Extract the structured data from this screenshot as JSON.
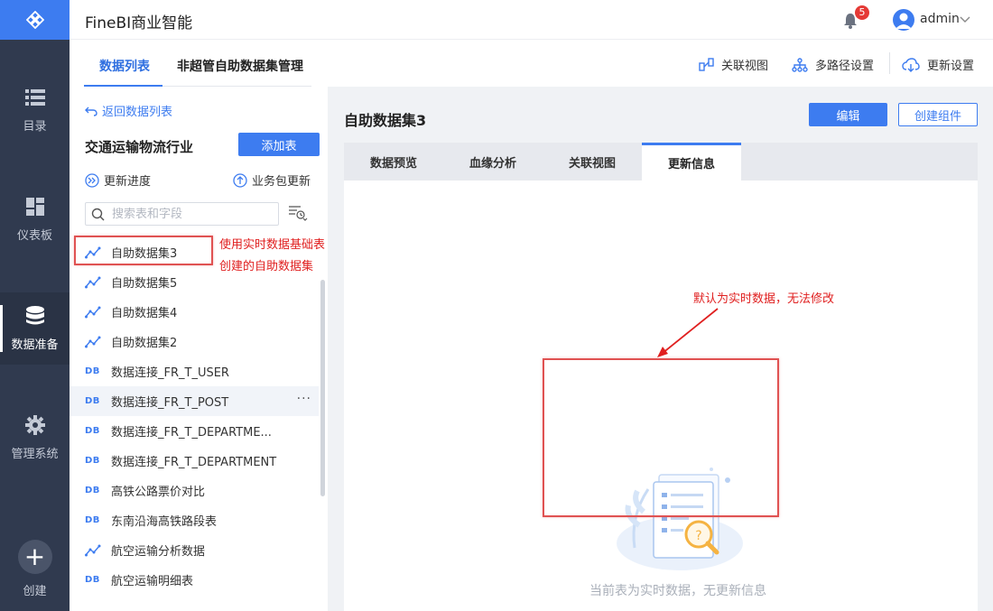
{
  "app": {
    "title": "FineBI商业智能"
  },
  "header": {
    "notification_count": "5",
    "username": "admin"
  },
  "sidebar": {
    "items": [
      {
        "label": "目录",
        "icon": "list-icon"
      },
      {
        "label": "仪表板",
        "icon": "dashboard-icon"
      },
      {
        "label": "数据准备",
        "icon": "database-icon",
        "active": true
      },
      {
        "label": "管理系统",
        "icon": "gear-icon"
      },
      {
        "label": "创建",
        "icon": "plus-icon"
      }
    ]
  },
  "subheader": {
    "tabs": [
      "数据列表",
      "非超管自助数据集管理"
    ],
    "tools": [
      "关联视图",
      "多路径设置",
      "更新设置"
    ]
  },
  "left_panel": {
    "back_link": "返回数据列表",
    "package_title": "交通运输物流行业",
    "add_table_button": "添加表",
    "progress_link": "更新进度",
    "package_update_link": "业务包更新",
    "search_placeholder": "搜索表和字段",
    "tables": [
      {
        "name": "自助数据集3",
        "type": "self-service"
      },
      {
        "name": "自助数据集5",
        "type": "self-service"
      },
      {
        "name": "自助数据集4",
        "type": "self-service"
      },
      {
        "name": "自助数据集2",
        "type": "self-service"
      },
      {
        "name": "数据连接_FR_T_USER",
        "type": "db"
      },
      {
        "name": "数据连接_FR_T_POST",
        "type": "db"
      },
      {
        "name": "数据连接_FR_T_DEPARTME...",
        "type": "db"
      },
      {
        "name": "数据连接_FR_T_DEPARTMENT",
        "type": "db"
      },
      {
        "name": "高铁公路票价对比",
        "type": "db"
      },
      {
        "name": "东南沿海高铁路段表",
        "type": "db"
      },
      {
        "name": "航空运输分析数据",
        "type": "self-service"
      },
      {
        "name": "航空运输明细表",
        "type": "db"
      }
    ],
    "db_badge": "DB",
    "more_dots": "···"
  },
  "annotations": {
    "side_note_line1": "使用实时数据基础表",
    "side_note_line2": "创建的自助数据集",
    "arrow_note": "默认为实时数据，无法修改"
  },
  "right_panel": {
    "dataset_title": "自助数据集3",
    "edit_button": "编辑",
    "create_component_button": "创建组件",
    "tabs": [
      "数据预览",
      "血缘分析",
      "关联视图",
      "更新信息"
    ],
    "active_tab": "更新信息",
    "empty_message": "当前表为实时数据，无更新信息"
  },
  "colors": {
    "accent": "#3d7cf0",
    "sidebar": "#303a4f",
    "annotation": "#e02020"
  }
}
